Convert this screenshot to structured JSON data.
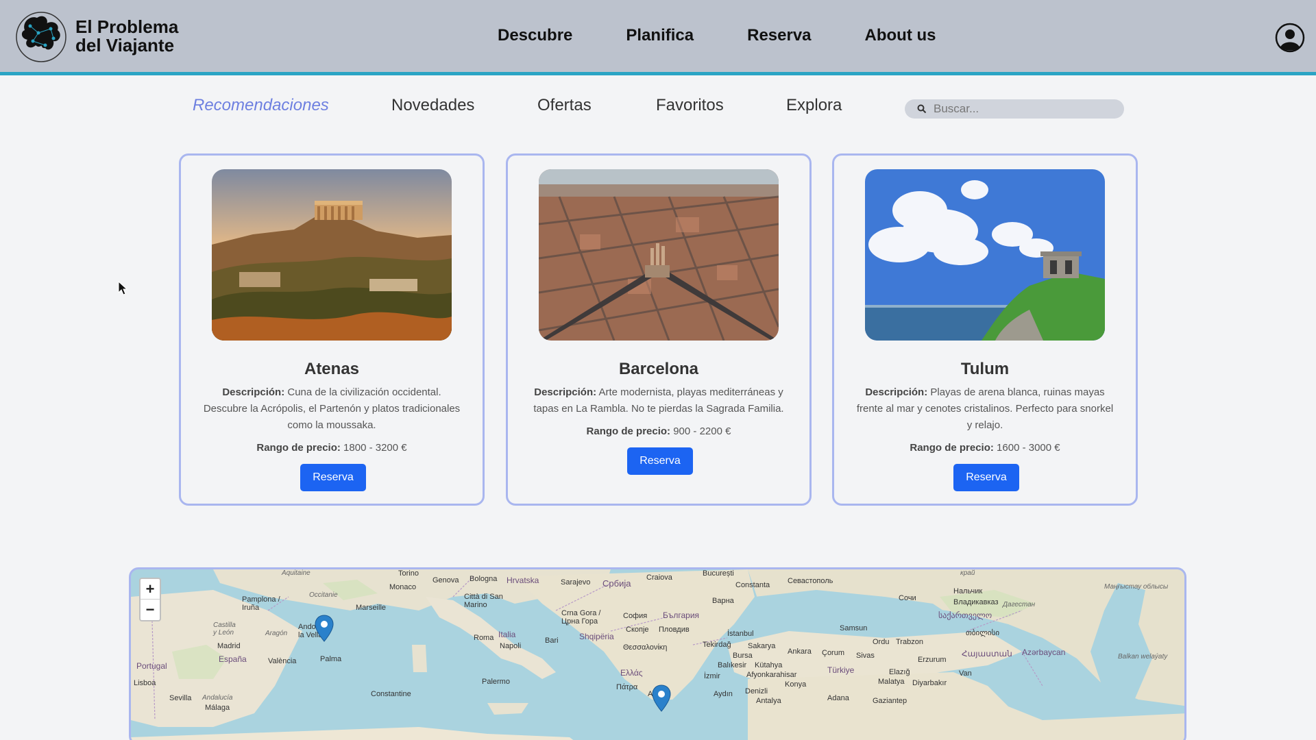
{
  "brand": {
    "line1": "El Problema",
    "line2": "del Viajante"
  },
  "nav": {
    "items": [
      "Descubre",
      "Planifica",
      "Reserva",
      "About us"
    ]
  },
  "tabs": [
    "Recomendaciones",
    "Novedades",
    "Ofertas",
    "Favoritos",
    "Explora"
  ],
  "search": {
    "placeholder": "Buscar..."
  },
  "cards": [
    {
      "title": "Atenas",
      "desc_label": "Descripción:",
      "desc": "Cuna de la civilización occidental. Descubre la Acrópolis, el Partenón y platos tradicionales como la moussaka.",
      "price_label": "Rango de precio:",
      "price": "1800 - 3200 €",
      "button": "Reserva"
    },
    {
      "title": "Barcelona",
      "desc_label": "Descripción:",
      "desc": "Arte modernista, playas mediterráneas y tapas en La Rambla. No te pierdas la Sagrada Familia.",
      "price_label": "Rango de precio:",
      "price": "900 - 2200 €",
      "button": "Reserva"
    },
    {
      "title": "Tulum",
      "desc_label": "Descripción:",
      "desc": "Playas de arena blanca, ruinas mayas frente al mar y cenotes cristalinos. Perfecto para snorkel y relajo.",
      "price_label": "Rango de precio:",
      "price": "1600 - 3000 €",
      "button": "Reserva"
    }
  ],
  "map": {
    "zoom_in": "+",
    "zoom_out": "−",
    "labels": {
      "torino": "Torino",
      "genova": "Genova",
      "bologna": "Bologna",
      "hrvatska": "Hrvatska",
      "sarajevo": "Sarajevo",
      "srbija": "Србија",
      "craiova": "Craiova",
      "bucuresti": "București",
      "constanta": "Constanta",
      "sevastopol": "Севастополь",
      "monaco": "Monaco",
      "sanmarino": "Città di San Marino",
      "pamplona": "Pamplona / Iruña",
      "occitanie": "Occitanie",
      "aquitaine": "Aquitaine",
      "marseille": "Marseille",
      "andorra": "Andorra la Vella",
      "crnagora": "Crna Gora / Црна Гора",
      "sofia": "София",
      "bulgaria": "България",
      "varna": "Варна",
      "skopje": "Скопје",
      "plovdiv": "Пловдив",
      "roma": "Roma",
      "italia": "Italia",
      "castilla": "Castilla y León",
      "aragon": "Aragón",
      "madrid": "Madrid",
      "espana": "España",
      "valencia": "València",
      "palma": "Palma",
      "napoli": "Napoli",
      "bari": "Bari",
      "shqiperia": "Shqipëria",
      "portugal": "Portugal",
      "lisboa": "Lisboa",
      "sevilla": "Sevilla",
      "andalucia": "Andalucía",
      "malaga": "Málaga",
      "thessaloniki": "Θεσσαλονίκη",
      "ellas": "Ελλάς",
      "patra": "Πάτρα",
      "athina": "Αθήνα",
      "palermo": "Palermo",
      "constantine": "Constantine",
      "istanbul": "İstanbul",
      "tekirdag": "Tekirdağ",
      "sakarya": "Sakarya",
      "bursa": "Bursa",
      "balikesir": "Balıkesir",
      "izmir": "İzmir",
      "aydin": "Aydın",
      "ankara": "Ankara",
      "kutahya": "Kütahya",
      "afyon": "Afyonkarahisar",
      "konya": "Konya",
      "denizli": "Denizli",
      "antalya": "Antalya",
      "corum": "Çorum",
      "sivas": "Sivas",
      "turkiye": "Türkiye",
      "adana": "Adana",
      "samsun": "Samsun",
      "ordu": "Ordu",
      "trabzon": "Trabzon",
      "erzurum": "Erzurum",
      "elazig": "Elazığ",
      "malatya": "Malatya",
      "diyarbakir": "Diyarbakır",
      "van": "Van",
      "gaziantep": "Gaziantep",
      "sochi": "Сочи",
      "nalchik": "Нальчик",
      "vladikavkaz": "Владикавказ",
      "sakartvelo": "საქართველო",
      "tbilisi": "თბილისი",
      "hayastan": "Հայաստան",
      "azerbaycan": "Azərbaycan",
      "dagestan": "Дагестан",
      "krai": "край",
      "mangystau": "Маңғыстау облысы",
      "balkan": "Balkan welaýaty"
    }
  },
  "icons": {
    "logo": "globe-head-logo",
    "user": "user-circle-icon",
    "search": "search-icon",
    "pin": "map-pin-icon"
  },
  "colors": {
    "accent": "#6d7fe0",
    "button": "#1c64f2",
    "header": "#bcc2cd",
    "header_border": "#2aa4c4",
    "card_border": "#a9b6ef"
  }
}
